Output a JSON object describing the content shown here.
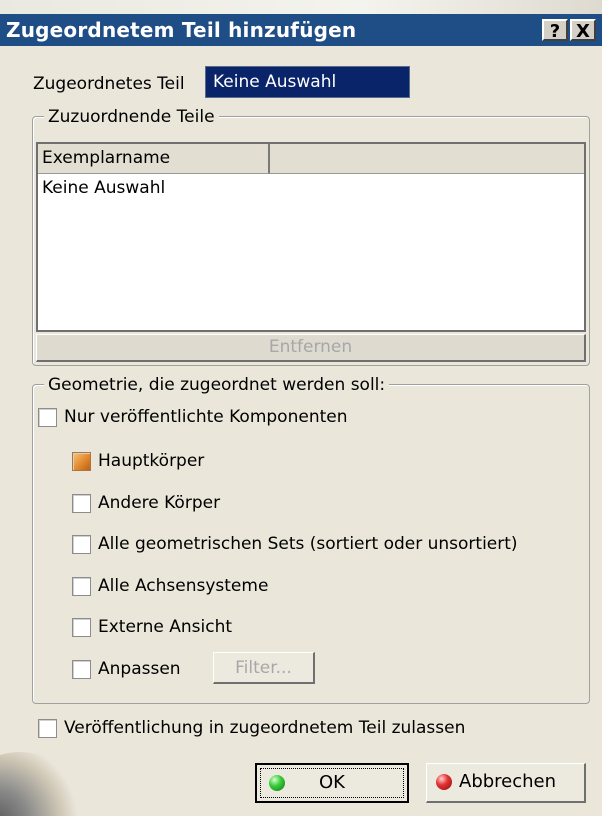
{
  "window": {
    "title": "Zugeordnetem Teil hinzufügen",
    "help_btn": "?",
    "close_btn": "X"
  },
  "associated_part": {
    "label": "Zugeordnetes Teil",
    "value": "Keine Auswahl"
  },
  "parts_group": {
    "legend": "Zuzuordnende Teile",
    "columns": [
      "Exemplarname",
      ""
    ],
    "rows": [
      "Keine Auswahl"
    ],
    "remove_button": "Entfernen"
  },
  "geometry_group": {
    "legend": "Geometrie, die zugeordnet werden soll:",
    "options": [
      {
        "label": "Nur veröffentlichte Komponenten",
        "state": "unchecked"
      },
      {
        "label": "Hauptkörper",
        "state": "mixed"
      },
      {
        "label": "Andere Körper",
        "state": "unchecked"
      },
      {
        "label": "Alle geometrischen Sets (sortiert oder unsortiert)",
        "state": "unchecked"
      },
      {
        "label": "Alle Achsensysteme",
        "state": "unchecked"
      },
      {
        "label": "Externe Ansicht",
        "state": "unchecked"
      },
      {
        "label": "Anpassen",
        "state": "unchecked"
      }
    ],
    "filter_button": "Filter..."
  },
  "publish_option": {
    "label": "Veröffentlichung in zugeordnetem Teil zulassen",
    "state": "unchecked"
  },
  "buttons": {
    "ok": "OK",
    "cancel": "Abbrechen"
  },
  "colors": {
    "titlebar": "#1f4e86",
    "dialog_bg": "#eae6da",
    "selection": "#0a246a",
    "disabled_text": "#a7a7a7"
  },
  "icons": [
    "help-icon",
    "close-icon",
    "ok-led-icon",
    "cancel-led-icon"
  ]
}
